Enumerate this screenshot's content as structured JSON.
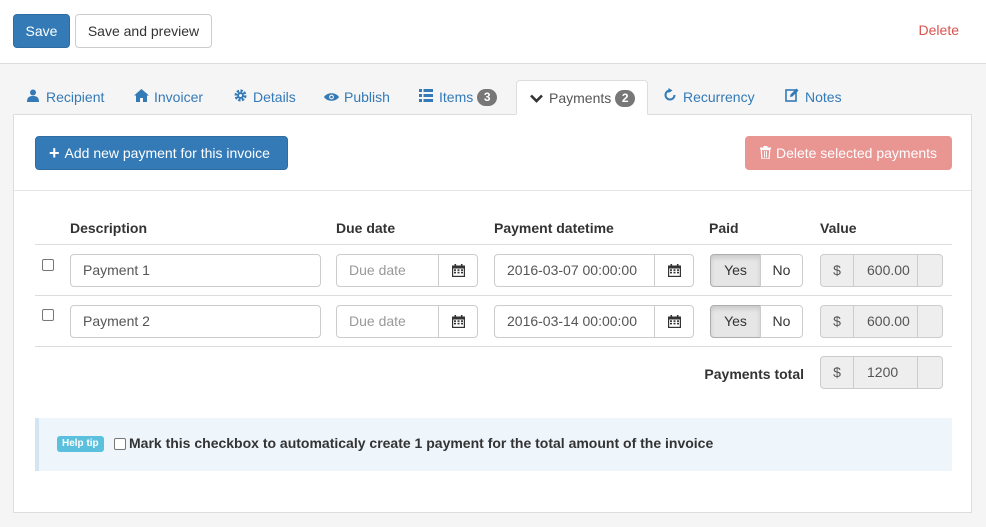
{
  "toolbar": {
    "save_label": "Save",
    "save_preview_label": "Save and preview",
    "delete_label": "Delete"
  },
  "tabs": [
    {
      "label": "Recipient",
      "icon": "user-icon"
    },
    {
      "label": "Invoicer",
      "icon": "home-icon"
    },
    {
      "label": "Details",
      "icon": "gear-icon"
    },
    {
      "label": "Publish",
      "icon": "eye-icon"
    },
    {
      "label": "Items",
      "icon": "list-icon",
      "badge": "3"
    },
    {
      "label": "Payments",
      "icon": "chevron-down-icon",
      "badge": "2",
      "active": true
    },
    {
      "label": "Recurrency",
      "icon": "refresh-icon"
    },
    {
      "label": "Notes",
      "icon": "edit-icon"
    }
  ],
  "payments": {
    "add_label": "Add new payment for this invoice",
    "delete_selected_label": "Delete selected payments",
    "columns": {
      "description": "Description",
      "due_date": "Due date",
      "payment_datetime": "Payment datetime",
      "paid": "Paid",
      "value": "Value"
    },
    "rows": [
      {
        "description": "Payment 1",
        "due_date_placeholder": "Due date",
        "payment_datetime": "2016-03-07 00:00:00",
        "paid_yes": "Yes",
        "paid_no": "No",
        "currency": "$",
        "value": "600.00"
      },
      {
        "description": "Payment 2",
        "due_date_placeholder": "Due date",
        "payment_datetime": "2016-03-14 00:00:00",
        "paid_yes": "Yes",
        "paid_no": "No",
        "currency": "$",
        "value": "600.00"
      }
    ],
    "total_label": "Payments total",
    "total_currency": "$",
    "total_value": "1200"
  },
  "help": {
    "tip_label": "Help tip",
    "text": "Mark this checkbox to automaticaly create 1 payment for the total amount of the invoice"
  }
}
